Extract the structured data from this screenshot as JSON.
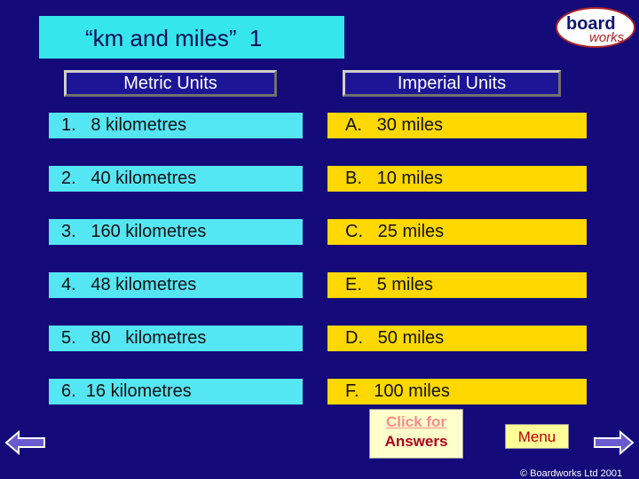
{
  "title": "“km and miles”  1",
  "logo": {
    "line1": "board",
    "line2": "works"
  },
  "headers": {
    "metric": "Metric Units",
    "imperial": "Imperial  Units"
  },
  "metric": [
    "1.   8 kilometres",
    "2.   40 kilometres",
    "3.   160 kilometres",
    "4.   48 kilometres",
    "5.   80   kilometres",
    "6.  16 kilometres"
  ],
  "imperial": [
    "A.   30 miles",
    "B.   10 miles",
    "C.   25 miles",
    "E.   5 miles",
    "D.   50 miles",
    "F.   100 miles"
  ],
  "answers_button": {
    "line1": "Click for",
    "line2": "Answers"
  },
  "menu_label": "Menu",
  "copyright": "© Boardworks Ltd 2001",
  "colors": {
    "background": "#140a7a",
    "metric_fill": "#55e6f4",
    "imperial_fill": "#ffd800",
    "arrow_fill": "#6a5acd"
  }
}
